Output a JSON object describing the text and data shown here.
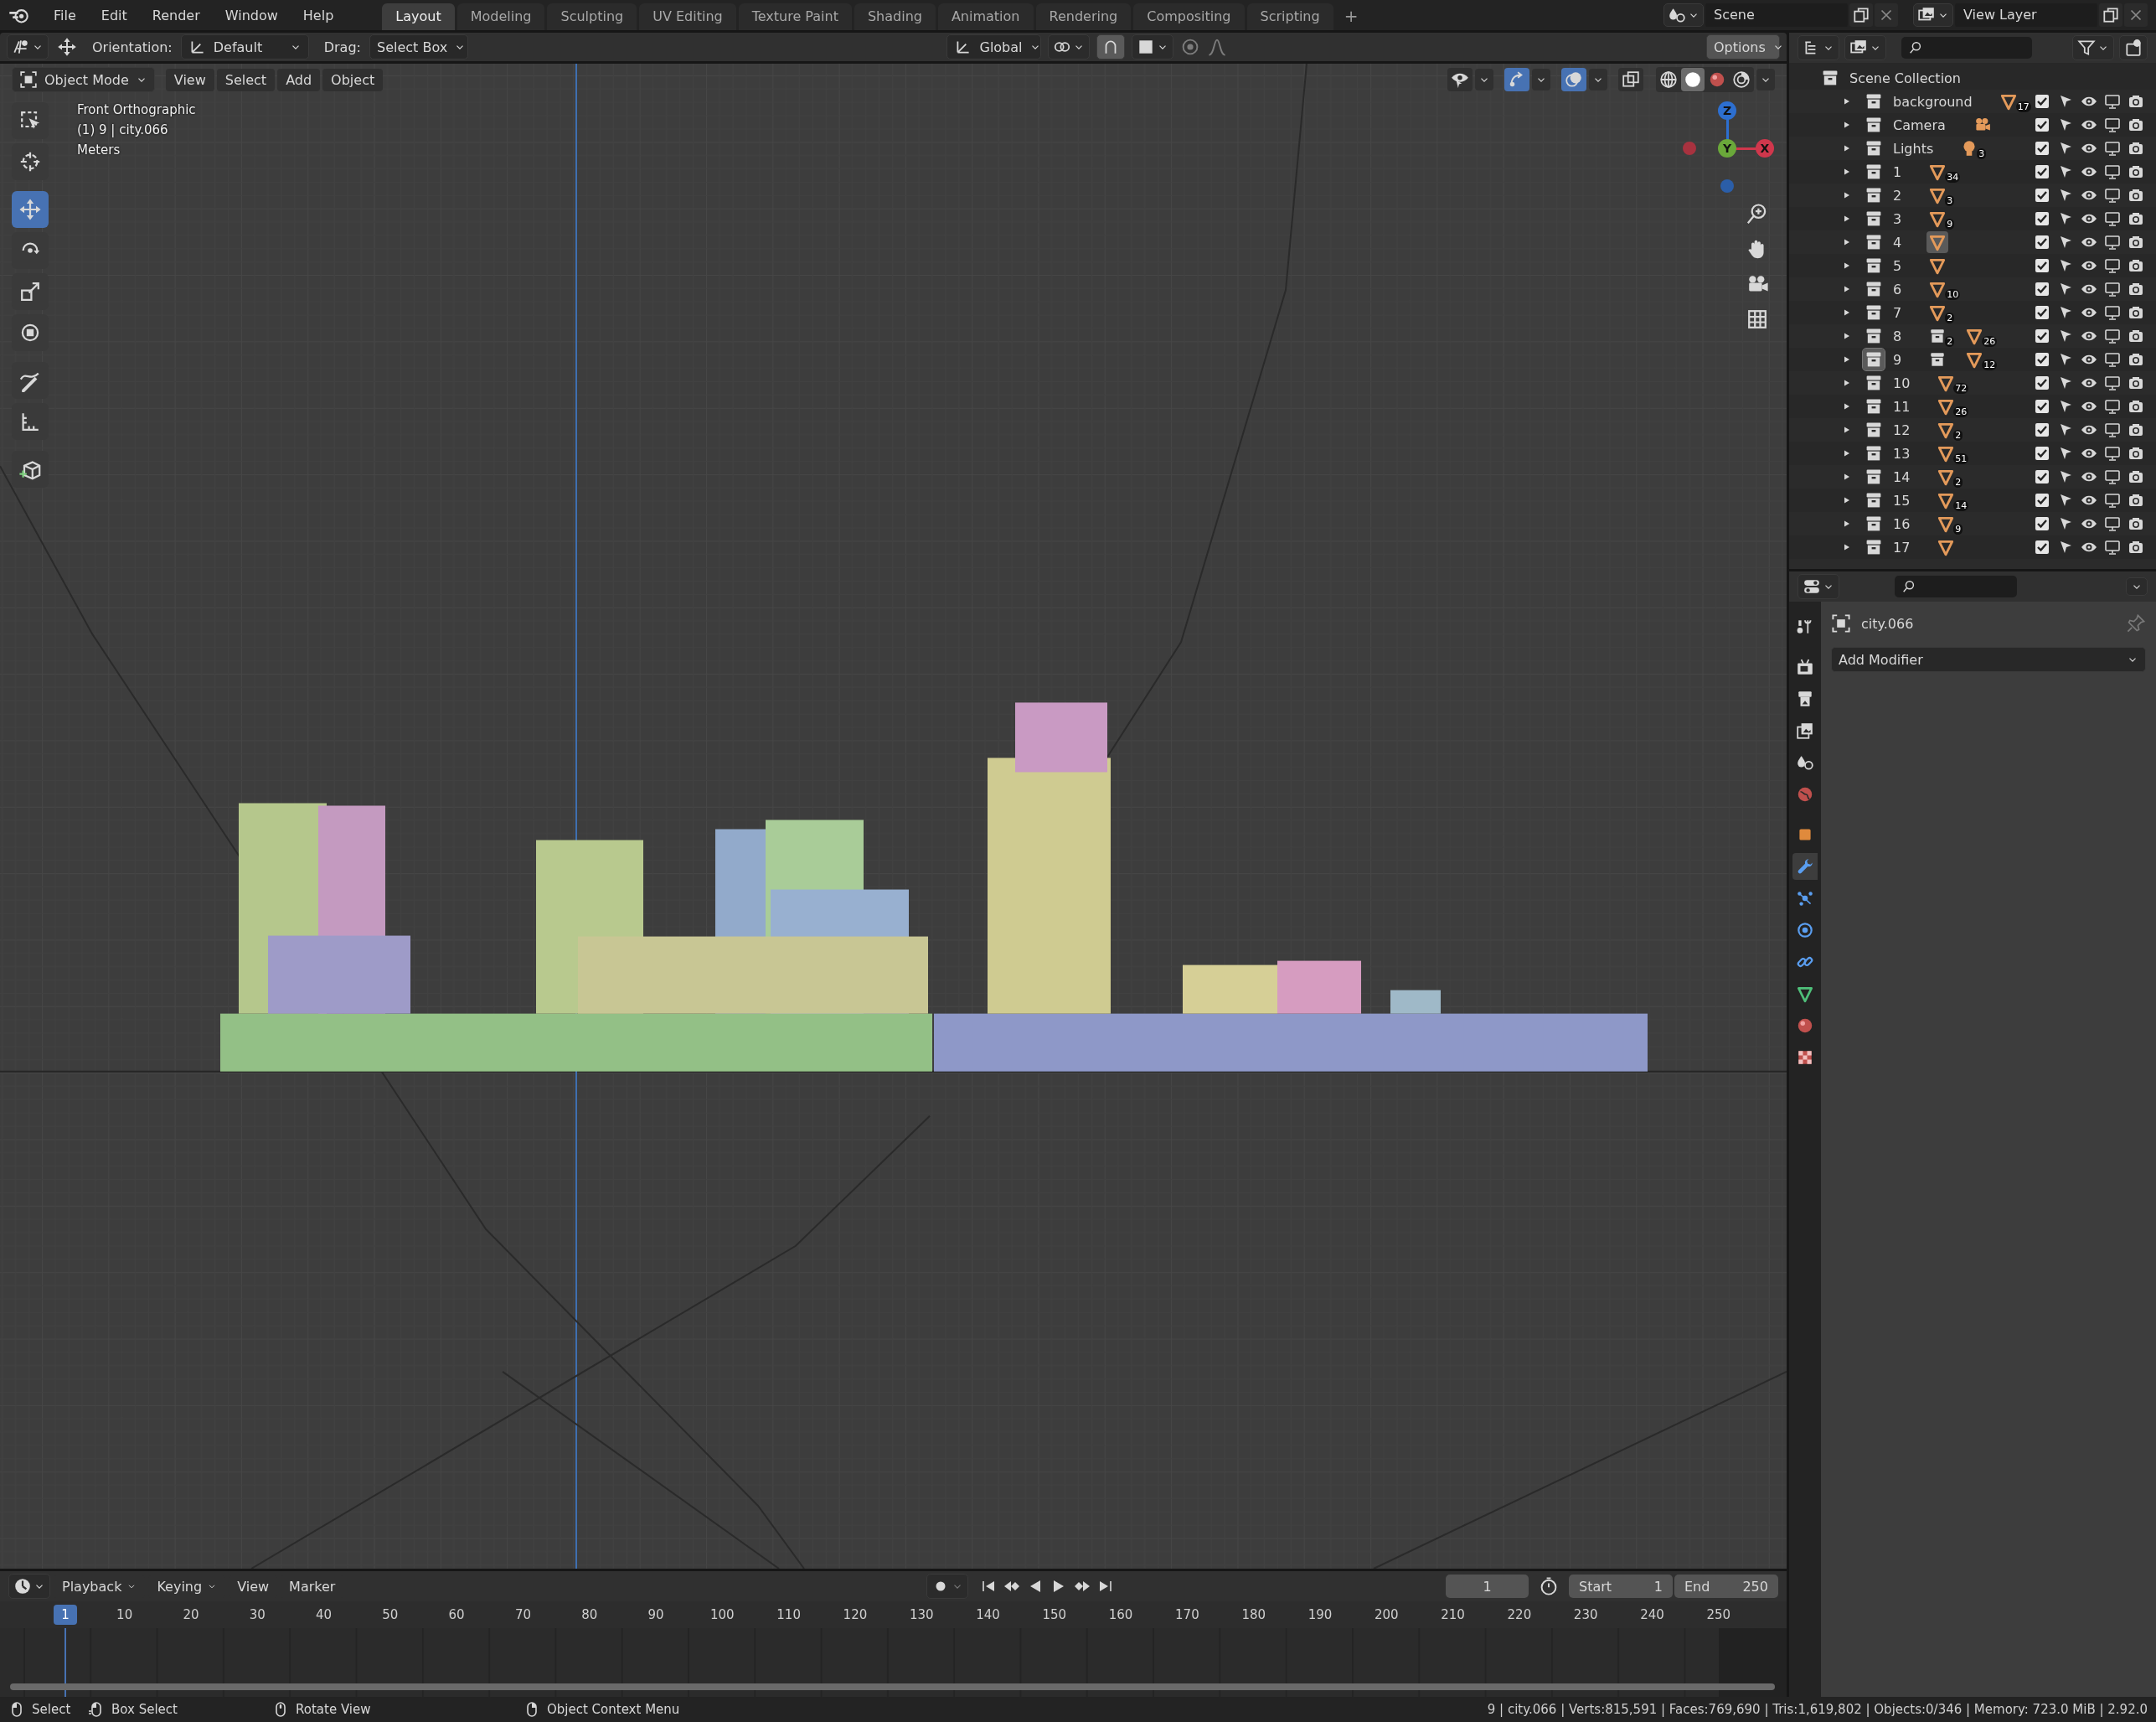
{
  "topbar": {
    "menus": [
      "File",
      "Edit",
      "Render",
      "Window",
      "Help"
    ],
    "workspaces": [
      {
        "label": "Layout",
        "selected": true
      },
      {
        "label": "Modeling",
        "selected": false
      },
      {
        "label": "Sculpting",
        "selected": false
      },
      {
        "label": "UV Editing",
        "selected": false
      },
      {
        "label": "Texture Paint",
        "selected": false
      },
      {
        "label": "Shading",
        "selected": false
      },
      {
        "label": "Animation",
        "selected": false
      },
      {
        "label": "Rendering",
        "selected": false
      },
      {
        "label": "Compositing",
        "selected": false
      },
      {
        "label": "Scripting",
        "selected": false
      }
    ],
    "add_workspace": "+",
    "scene": "Scene",
    "view_layer": "View Layer"
  },
  "viewport_header": {
    "orientation_label": "Orientation:",
    "orientation": "Default",
    "drag_label": "Drag:",
    "drag": "Select Box",
    "transform": "Global",
    "snap_on": true,
    "options": "Options"
  },
  "viewport": {
    "mode": "Object Mode",
    "menus": [
      "View",
      "Select",
      "Add",
      "Object"
    ],
    "info": [
      "Front Orthographic",
      "(1) 9 | city.066",
      "Meters"
    ],
    "tools": [
      {
        "kind": "select",
        "selected": false
      },
      {
        "kind": "cursor",
        "selected": false
      },
      {
        "kind": "move",
        "selected": true
      },
      {
        "kind": "rotate",
        "selected": false
      },
      {
        "kind": "scale",
        "selected": false
      },
      {
        "kind": "transform",
        "selected": false
      },
      {
        "kind": "annotate",
        "selected": false
      },
      {
        "kind": "measure",
        "selected": false
      },
      {
        "kind": "cube",
        "selected": false
      }
    ],
    "toggles": [
      {
        "kind": "visibility",
        "on": false
      },
      {
        "kind": "gizmos",
        "on": true
      },
      {
        "kind": "overlays",
        "on": true
      },
      {
        "kind": "xray",
        "on": false
      }
    ],
    "shading": [
      {
        "kind": "wireframe",
        "selected": false
      },
      {
        "kind": "solid",
        "selected": true
      },
      {
        "kind": "material",
        "selected": false
      },
      {
        "kind": "rendered",
        "selected": false
      }
    ],
    "axes": [
      {
        "label": "Z",
        "color": "#2d6fd0"
      },
      {
        "label": "Y",
        "color": "#6aa83a"
      },
      {
        "label": "X",
        "color": "#d0374c"
      }
    ]
  },
  "outliner": {
    "root": "Scene Collection",
    "items": [
      {
        "name": "background",
        "active": false,
        "checked": true,
        "content": [
          {
            "kind": "mesh",
            "count": "17",
            "highlighted": false
          }
        ]
      },
      {
        "name": "Camera",
        "active": false,
        "checked": true,
        "content": [
          {
            "kind": "camera",
            "highlighted": false
          }
        ]
      },
      {
        "name": "Lights",
        "active": false,
        "checked": true,
        "content": [
          {
            "kind": "light",
            "count": "3",
            "highlighted": false
          }
        ]
      },
      {
        "name": "1",
        "active": false,
        "checked": true,
        "content": [
          {
            "kind": "mesh",
            "count": "34",
            "highlighted": false
          }
        ]
      },
      {
        "name": "2",
        "active": false,
        "checked": true,
        "content": [
          {
            "kind": "mesh",
            "count": "3",
            "highlighted": false
          }
        ]
      },
      {
        "name": "3",
        "active": false,
        "checked": true,
        "content": [
          {
            "kind": "mesh",
            "count": "9",
            "highlighted": false
          }
        ]
      },
      {
        "name": "4",
        "active": false,
        "checked": true,
        "content": [
          {
            "kind": "mesh",
            "highlighted": true
          }
        ]
      },
      {
        "name": "5",
        "active": false,
        "checked": true,
        "content": [
          {
            "kind": "mesh",
            "highlighted": false
          }
        ]
      },
      {
        "name": "6",
        "active": false,
        "checked": true,
        "content": [
          {
            "kind": "mesh",
            "count": "10",
            "highlighted": false
          }
        ]
      },
      {
        "name": "7",
        "active": false,
        "checked": true,
        "content": [
          {
            "kind": "mesh",
            "count": "2",
            "highlighted": false
          }
        ]
      },
      {
        "name": "8",
        "active": false,
        "checked": true,
        "content": [
          {
            "kind": "collection",
            "count": "2",
            "highlighted": false
          },
          {
            "kind": "mesh",
            "count": "26",
            "highlighted": false
          }
        ]
      },
      {
        "name": "9",
        "active": true,
        "checked": true,
        "content": [
          {
            "kind": "collection",
            "highlighted": false
          },
          {
            "kind": "mesh",
            "count": "12",
            "highlighted": false
          }
        ]
      },
      {
        "name": "10",
        "active": false,
        "checked": true,
        "content": [
          {
            "kind": "mesh",
            "count": "72",
            "highlighted": false
          }
        ]
      },
      {
        "name": "11",
        "active": false,
        "checked": true,
        "content": [
          {
            "kind": "mesh",
            "count": "26",
            "highlighted": false
          }
        ]
      },
      {
        "name": "12",
        "active": false,
        "checked": true,
        "content": [
          {
            "kind": "mesh",
            "count": "2",
            "highlighted": false
          }
        ]
      },
      {
        "name": "13",
        "active": false,
        "checked": true,
        "content": [
          {
            "kind": "mesh",
            "count": "51",
            "highlighted": false
          }
        ]
      },
      {
        "name": "14",
        "active": false,
        "checked": true,
        "content": [
          {
            "kind": "mesh",
            "count": "2",
            "highlighted": false
          }
        ]
      },
      {
        "name": "15",
        "active": false,
        "checked": true,
        "content": [
          {
            "kind": "mesh",
            "count": "14",
            "highlighted": false
          }
        ]
      },
      {
        "name": "16",
        "active": false,
        "checked": true,
        "content": [
          {
            "kind": "mesh",
            "count": "9",
            "highlighted": false
          }
        ]
      },
      {
        "name": "17",
        "active": false,
        "checked": true,
        "content": [
          {
            "kind": "mesh",
            "highlighted": false
          }
        ]
      }
    ]
  },
  "properties": {
    "tabs": [
      {
        "kind": "tool",
        "selected": false
      },
      {
        "kind": "render",
        "selected": false
      },
      {
        "kind": "output",
        "selected": false
      },
      {
        "kind": "viewlayer",
        "selected": false
      },
      {
        "kind": "scene",
        "selected": false
      },
      {
        "kind": "world",
        "selected": false
      },
      {
        "kind": "object",
        "selected": false
      },
      {
        "kind": "modifier",
        "selected": true
      },
      {
        "kind": "particles",
        "selected": false
      },
      {
        "kind": "physics",
        "selected": false
      },
      {
        "kind": "constraints",
        "selected": false
      },
      {
        "kind": "data",
        "selected": false
      },
      {
        "kind": "material",
        "selected": false
      },
      {
        "kind": "texture",
        "selected": false
      }
    ],
    "object": "city.066",
    "button": "Add Modifier"
  },
  "timeline": {
    "menus": [
      "Playback",
      "Keying",
      "View",
      "Marker"
    ],
    "frame": "1",
    "start_label": "Start",
    "start": "1",
    "end_label": "End",
    "end": "250",
    "current": "1",
    "ticks": [
      "10",
      "20",
      "30",
      "40",
      "50",
      "60",
      "70",
      "80",
      "90",
      "100",
      "110",
      "120",
      "130",
      "140",
      "150",
      "160",
      "170",
      "180",
      "190",
      "200",
      "210",
      "220",
      "230",
      "240",
      "250"
    ]
  },
  "status_bar": {
    "hints": [
      {
        "kind": "left",
        "label": "Select"
      },
      {
        "kind": "drag",
        "label": "Box Select"
      },
      {
        "kind": "middle",
        "label": "Rotate View"
      },
      {
        "kind": "right",
        "label": "Object Context Menu"
      }
    ],
    "stats": "9 | city.066 | Verts:815,591 | Faces:769,690 | Tris:1,619,802 | Objects:0/346 | Memory: 723.0 MiB | 2.92.0"
  }
}
